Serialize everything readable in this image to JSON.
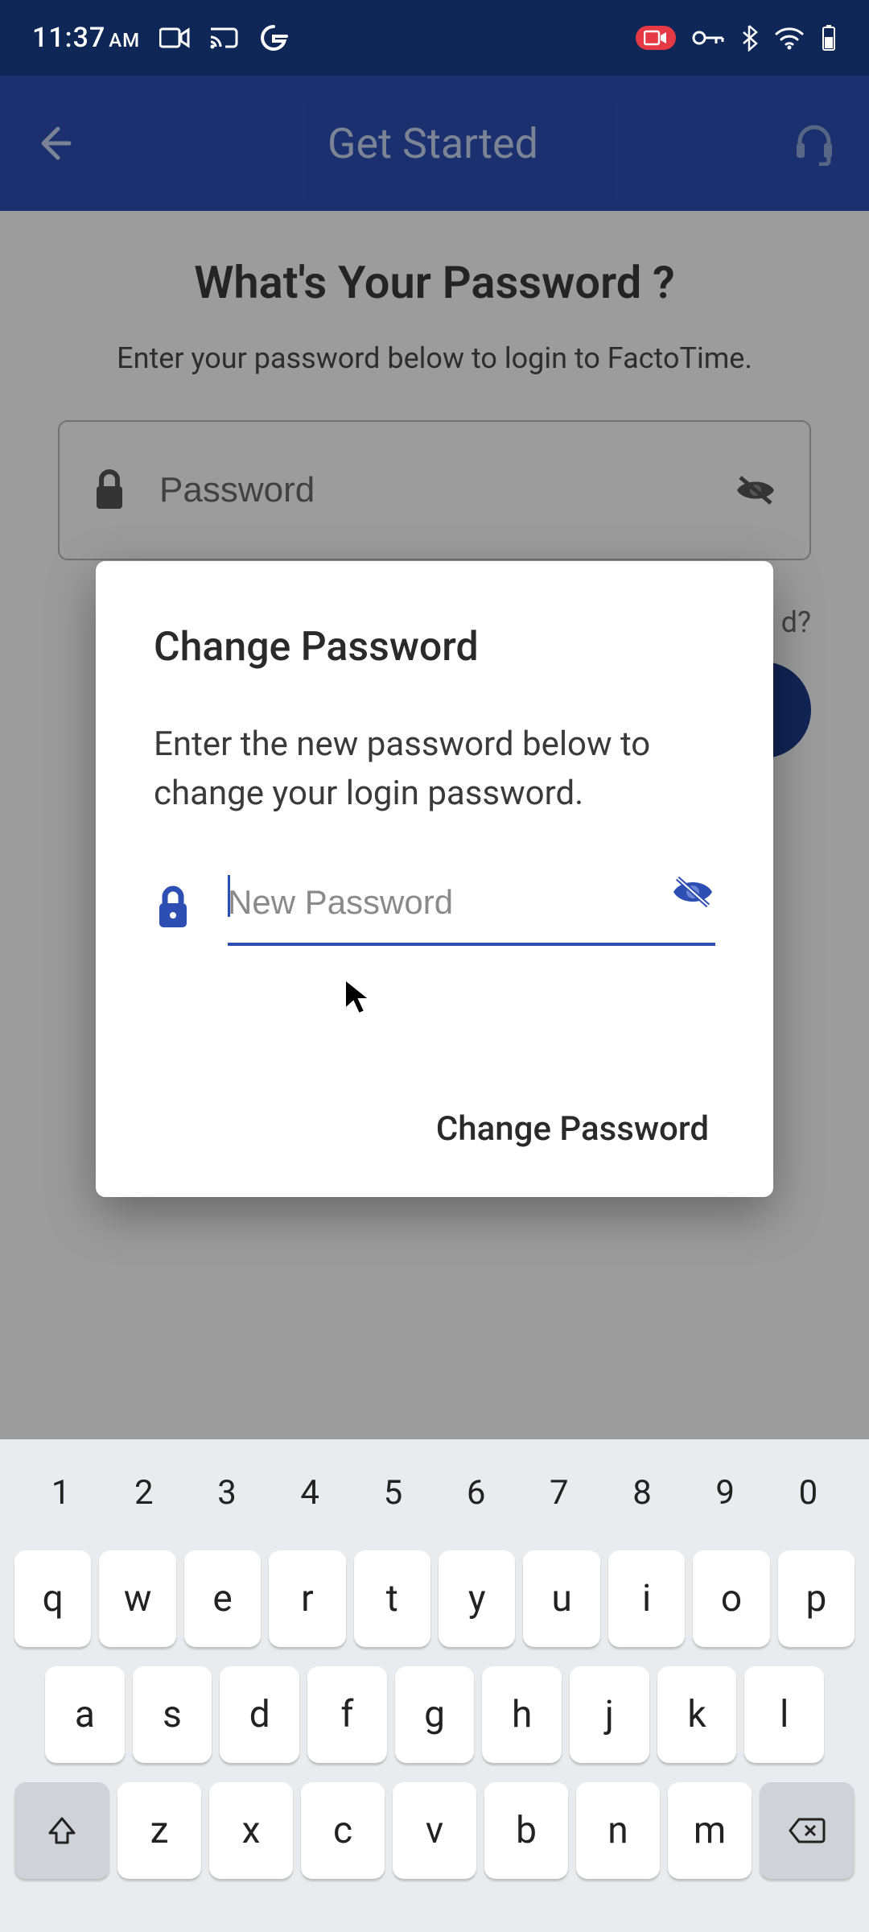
{
  "status": {
    "time": "11:37",
    "ampm": "AM"
  },
  "appbar": {
    "title": "Get Started"
  },
  "page": {
    "heading": "What's Your Password ?",
    "sub": "Enter your password below to login to FactoTime.",
    "password_placeholder": "Password",
    "forgot": "d?"
  },
  "modal": {
    "title": "Change Password",
    "text": "Enter the new password below to change your login password.",
    "placeholder": "New Password",
    "action": "Change Password"
  },
  "keyboard": {
    "nums": [
      "1",
      "2",
      "3",
      "4",
      "5",
      "6",
      "7",
      "8",
      "9",
      "0"
    ],
    "row1": [
      "q",
      "w",
      "e",
      "r",
      "t",
      "y",
      "u",
      "i",
      "o",
      "p"
    ],
    "row2": [
      "a",
      "s",
      "d",
      "f",
      "g",
      "h",
      "j",
      "k",
      "l"
    ],
    "row3": [
      "z",
      "x",
      "c",
      "v",
      "b",
      "n",
      "m"
    ]
  }
}
